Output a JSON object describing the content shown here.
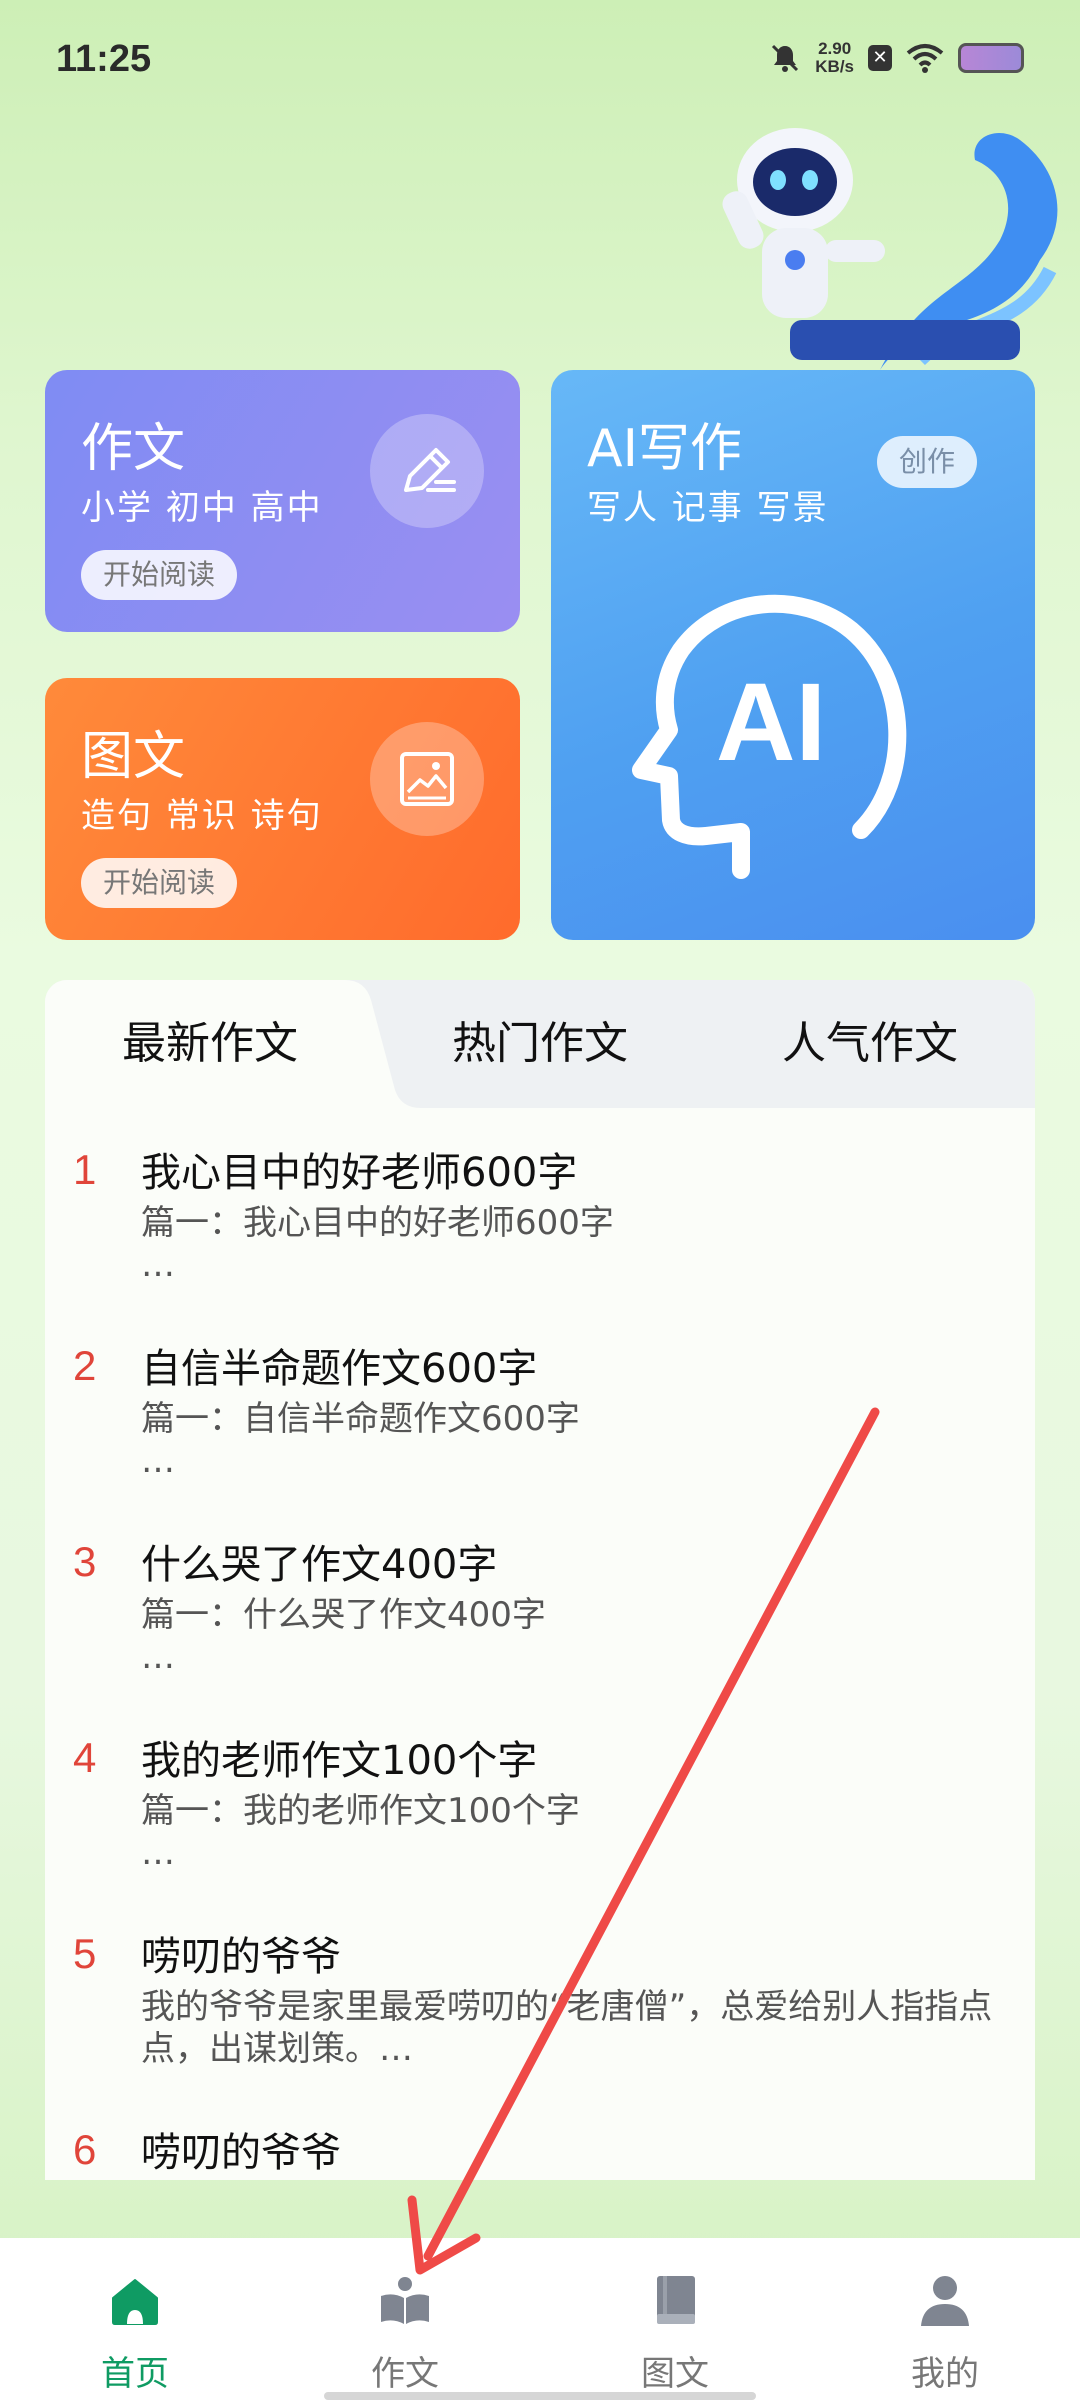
{
  "status": {
    "time": "11:25",
    "net_speed_value": "2.90",
    "net_speed_unit": "KB/s"
  },
  "cards": {
    "essay": {
      "title": "作文",
      "subtitle": "小学 初中 高中",
      "button": "开始阅读"
    },
    "image_text": {
      "title": "图文",
      "subtitle": "造句 常识 诗句",
      "button": "开始阅读"
    },
    "ai": {
      "title": "AI写作",
      "subtitle": "写人 记事 写景",
      "badge": "创作",
      "logo_text": "AI"
    }
  },
  "tabs": [
    {
      "label": "最新作文",
      "active": true
    },
    {
      "label": "热门作文",
      "active": false
    },
    {
      "label": "人气作文",
      "active": false
    }
  ],
  "list": [
    {
      "num": "1",
      "title": "我心目中的好老师600字",
      "desc": "篇一：我心目中的好老师600字\n…"
    },
    {
      "num": "2",
      "title": "自信半命题作文600字",
      "desc": "篇一：自信半命题作文600字\n…"
    },
    {
      "num": "3",
      "title": "什么哭了作文400字",
      "desc": "篇一：什么哭了作文400字\n…"
    },
    {
      "num": "4",
      "title": "我的老师作文100个字",
      "desc": "篇一：我的老师作文100个字\n…"
    },
    {
      "num": "5",
      "title": "唠叨的爷爷",
      "desc": "我的爷爷是家里最爱唠叨的“老唐僧”，总爱给别人指指点点，出谋划策。…"
    },
    {
      "num": "6",
      "title": "唠叨的爷爷",
      "desc": ""
    }
  ],
  "nav": [
    {
      "label": "首页",
      "icon": "home-icon",
      "active": true
    },
    {
      "label": "作文",
      "icon": "open-book-icon",
      "active": false
    },
    {
      "label": "图文",
      "icon": "book-icon",
      "active": false
    },
    {
      "label": "我的",
      "icon": "user-icon",
      "active": false
    }
  ],
  "colors": {
    "accent_green": "#0f9b63",
    "rank_red": "#e0453a",
    "annotation_arrow": "#ef4a47"
  }
}
